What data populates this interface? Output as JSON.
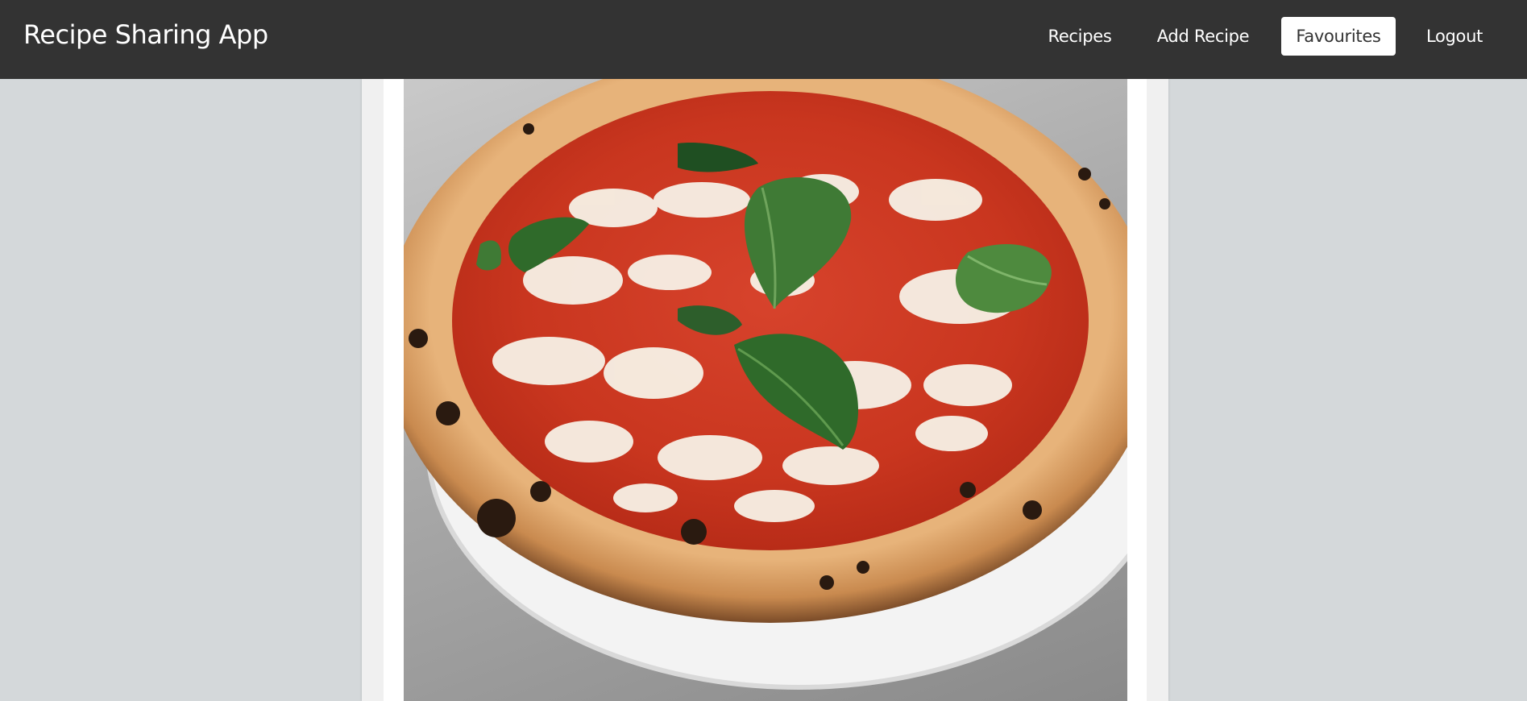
{
  "app": {
    "title": "Recipe Sharing App"
  },
  "nav": {
    "items": [
      {
        "label": "Recipes",
        "active": false
      },
      {
        "label": "Add Recipe",
        "active": false
      },
      {
        "label": "Favourites",
        "active": true
      },
      {
        "label": "Logout",
        "active": false
      }
    ]
  },
  "colors": {
    "navbar": "#333333",
    "background": "#d4d8da",
    "active_nav_bg": "#ffffff"
  },
  "recipe": {
    "image_subject": "margherita-pizza"
  }
}
